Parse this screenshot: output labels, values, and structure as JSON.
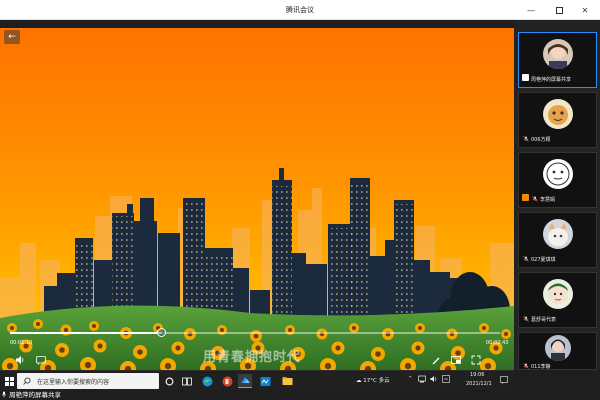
{
  "window": {
    "title": "腾讯会议",
    "controls": [
      "minimize",
      "maximize",
      "close"
    ]
  },
  "player": {
    "elapsed": "00:01:10",
    "total": "00:02:43",
    "progress_fraction": 0.31,
    "watermark": "用青春拥抱时代"
  },
  "participants": [
    {
      "name": "周艳萍的屏幕共享",
      "status": "sharing",
      "active": true
    },
    {
      "name": "006方颖",
      "status": "muted"
    },
    {
      "name": "李慧娟",
      "status": "host-muted"
    },
    {
      "name": "027夏琪琪",
      "status": "muted"
    },
    {
      "name": "葛舒哥代表",
      "status": "muted"
    },
    {
      "name": "011李静",
      "status": "muted"
    }
  ],
  "share_banner": {
    "label": "周艳萍的屏幕共享"
  },
  "taskbar": {
    "search_placeholder": "在这里输入你要搜索的内容",
    "weather_temp": "17°C",
    "weather_desc": "多云",
    "clock_time": "19:06",
    "clock_date": "2021/12/1"
  },
  "colors": {
    "sky_top": "#ff7a00",
    "sky_mid": "#ff9a00",
    "sky_low": "#ffc400",
    "accent": "#2a8cff",
    "grass": "#3d8a2a"
  }
}
